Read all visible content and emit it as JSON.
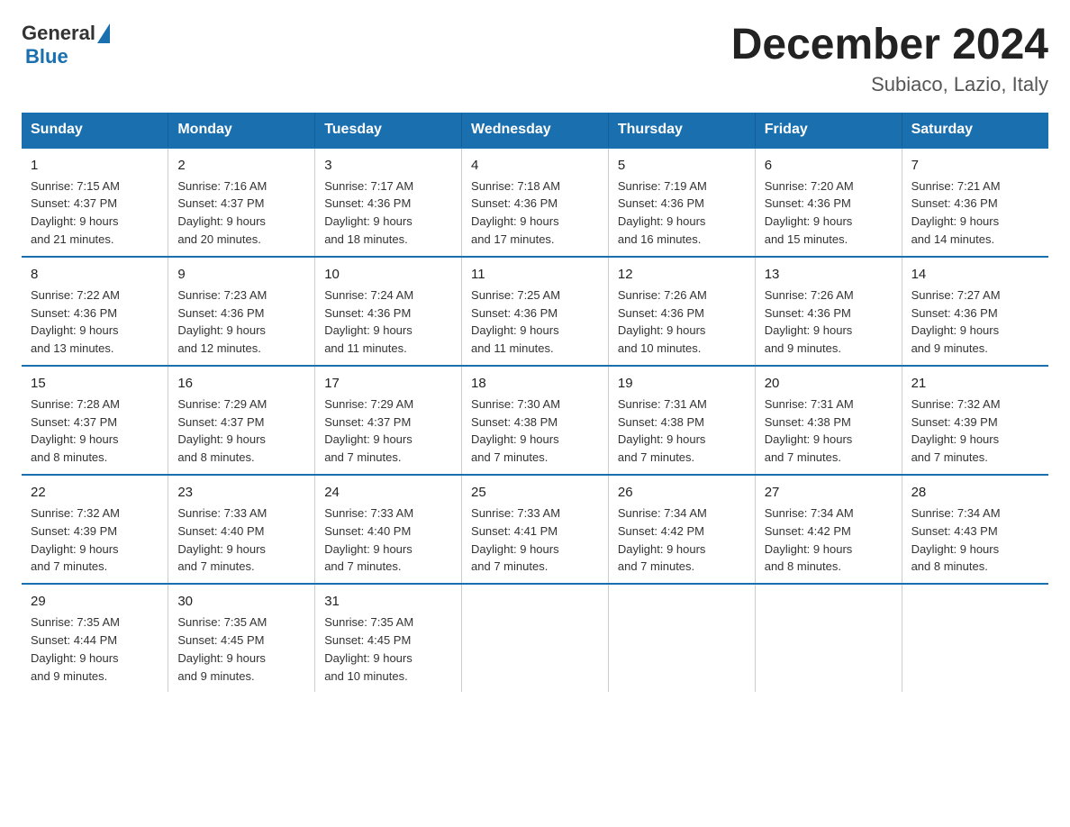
{
  "logo": {
    "general": "General",
    "blue": "Blue"
  },
  "title": "December 2024",
  "subtitle": "Subiaco, Lazio, Italy",
  "days_of_week": [
    "Sunday",
    "Monday",
    "Tuesday",
    "Wednesday",
    "Thursday",
    "Friday",
    "Saturday"
  ],
  "weeks": [
    [
      {
        "day": "1",
        "sunrise": "7:15 AM",
        "sunset": "4:37 PM",
        "daylight": "9 hours and 21 minutes."
      },
      {
        "day": "2",
        "sunrise": "7:16 AM",
        "sunset": "4:37 PM",
        "daylight": "9 hours and 20 minutes."
      },
      {
        "day": "3",
        "sunrise": "7:17 AM",
        "sunset": "4:36 PM",
        "daylight": "9 hours and 18 minutes."
      },
      {
        "day": "4",
        "sunrise": "7:18 AM",
        "sunset": "4:36 PM",
        "daylight": "9 hours and 17 minutes."
      },
      {
        "day": "5",
        "sunrise": "7:19 AM",
        "sunset": "4:36 PM",
        "daylight": "9 hours and 16 minutes."
      },
      {
        "day": "6",
        "sunrise": "7:20 AM",
        "sunset": "4:36 PM",
        "daylight": "9 hours and 15 minutes."
      },
      {
        "day": "7",
        "sunrise": "7:21 AM",
        "sunset": "4:36 PM",
        "daylight": "9 hours and 14 minutes."
      }
    ],
    [
      {
        "day": "8",
        "sunrise": "7:22 AM",
        "sunset": "4:36 PM",
        "daylight": "9 hours and 13 minutes."
      },
      {
        "day": "9",
        "sunrise": "7:23 AM",
        "sunset": "4:36 PM",
        "daylight": "9 hours and 12 minutes."
      },
      {
        "day": "10",
        "sunrise": "7:24 AM",
        "sunset": "4:36 PM",
        "daylight": "9 hours and 11 minutes."
      },
      {
        "day": "11",
        "sunrise": "7:25 AM",
        "sunset": "4:36 PM",
        "daylight": "9 hours and 11 minutes."
      },
      {
        "day": "12",
        "sunrise": "7:26 AM",
        "sunset": "4:36 PM",
        "daylight": "9 hours and 10 minutes."
      },
      {
        "day": "13",
        "sunrise": "7:26 AM",
        "sunset": "4:36 PM",
        "daylight": "9 hours and 9 minutes."
      },
      {
        "day": "14",
        "sunrise": "7:27 AM",
        "sunset": "4:36 PM",
        "daylight": "9 hours and 9 minutes."
      }
    ],
    [
      {
        "day": "15",
        "sunrise": "7:28 AM",
        "sunset": "4:37 PM",
        "daylight": "9 hours and 8 minutes."
      },
      {
        "day": "16",
        "sunrise": "7:29 AM",
        "sunset": "4:37 PM",
        "daylight": "9 hours and 8 minutes."
      },
      {
        "day": "17",
        "sunrise": "7:29 AM",
        "sunset": "4:37 PM",
        "daylight": "9 hours and 7 minutes."
      },
      {
        "day": "18",
        "sunrise": "7:30 AM",
        "sunset": "4:38 PM",
        "daylight": "9 hours and 7 minutes."
      },
      {
        "day": "19",
        "sunrise": "7:31 AM",
        "sunset": "4:38 PM",
        "daylight": "9 hours and 7 minutes."
      },
      {
        "day": "20",
        "sunrise": "7:31 AM",
        "sunset": "4:38 PM",
        "daylight": "9 hours and 7 minutes."
      },
      {
        "day": "21",
        "sunrise": "7:32 AM",
        "sunset": "4:39 PM",
        "daylight": "9 hours and 7 minutes."
      }
    ],
    [
      {
        "day": "22",
        "sunrise": "7:32 AM",
        "sunset": "4:39 PM",
        "daylight": "9 hours and 7 minutes."
      },
      {
        "day": "23",
        "sunrise": "7:33 AM",
        "sunset": "4:40 PM",
        "daylight": "9 hours and 7 minutes."
      },
      {
        "day": "24",
        "sunrise": "7:33 AM",
        "sunset": "4:40 PM",
        "daylight": "9 hours and 7 minutes."
      },
      {
        "day": "25",
        "sunrise": "7:33 AM",
        "sunset": "4:41 PM",
        "daylight": "9 hours and 7 minutes."
      },
      {
        "day": "26",
        "sunrise": "7:34 AM",
        "sunset": "4:42 PM",
        "daylight": "9 hours and 7 minutes."
      },
      {
        "day": "27",
        "sunrise": "7:34 AM",
        "sunset": "4:42 PM",
        "daylight": "9 hours and 8 minutes."
      },
      {
        "day": "28",
        "sunrise": "7:34 AM",
        "sunset": "4:43 PM",
        "daylight": "9 hours and 8 minutes."
      }
    ],
    [
      {
        "day": "29",
        "sunrise": "7:35 AM",
        "sunset": "4:44 PM",
        "daylight": "9 hours and 9 minutes."
      },
      {
        "day": "30",
        "sunrise": "7:35 AM",
        "sunset": "4:45 PM",
        "daylight": "9 hours and 9 minutes."
      },
      {
        "day": "31",
        "sunrise": "7:35 AM",
        "sunset": "4:45 PM",
        "daylight": "9 hours and 10 minutes."
      },
      null,
      null,
      null,
      null
    ]
  ],
  "labels": {
    "sunrise": "Sunrise:",
    "sunset": "Sunset:",
    "daylight": "Daylight:"
  }
}
